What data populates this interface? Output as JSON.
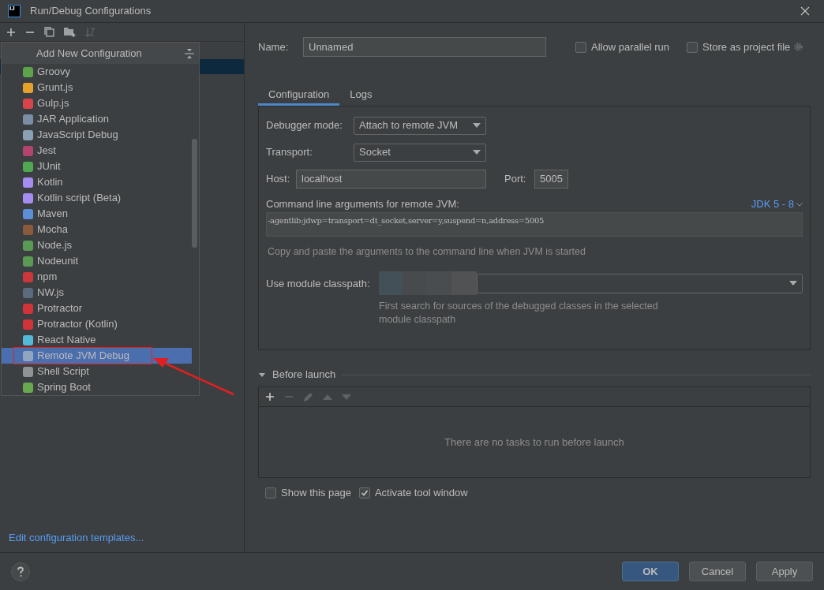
{
  "window": {
    "title": "Run/Debug Configurations",
    "logo": "IJ"
  },
  "popup": {
    "title": "Add New Configuration",
    "items": [
      {
        "label": "Groovy",
        "color": "#5ca34a",
        "selected": false
      },
      {
        "label": "Grunt.js",
        "color": "#e5a12c",
        "selected": false
      },
      {
        "label": "Gulp.js",
        "color": "#d9434b",
        "selected": false
      },
      {
        "label": "JAR Application",
        "color": "#7a8fa6",
        "selected": false
      },
      {
        "label": "JavaScript Debug",
        "color": "#8aa0b4",
        "selected": false
      },
      {
        "label": "Jest",
        "color": "#b4446e",
        "selected": false
      },
      {
        "label": "JUnit",
        "color": "#4fa852",
        "selected": false
      },
      {
        "label": "Kotlin",
        "color": "#a58cf0",
        "selected": false
      },
      {
        "label": "Kotlin script (Beta)",
        "color": "#a58cf0",
        "selected": false
      },
      {
        "label": "Maven",
        "color": "#5d8fd6",
        "selected": false
      },
      {
        "label": "Mocha",
        "color": "#8b5a3c",
        "selected": false
      },
      {
        "label": "Node.js",
        "color": "#5a9a55",
        "selected": false
      },
      {
        "label": "Nodeunit",
        "color": "#5a9a55",
        "selected": false
      },
      {
        "label": "npm",
        "color": "#c9373a",
        "selected": false
      },
      {
        "label": "NW.js",
        "color": "#5b6a7c",
        "selected": false
      },
      {
        "label": "Protractor",
        "color": "#d0343a",
        "selected": false
      },
      {
        "label": "Protractor (Kotlin)",
        "color": "#d0343a",
        "selected": false
      },
      {
        "label": "React Native",
        "color": "#54b9d8",
        "selected": false
      },
      {
        "label": "Remote JVM Debug",
        "color": "#8fa5c0",
        "selected": true
      },
      {
        "label": "Shell Script",
        "color": "#8e9398",
        "selected": false
      },
      {
        "label": "Spring Boot",
        "color": "#6aa84f",
        "selected": false
      }
    ]
  },
  "sidebar": {
    "link": "Edit configuration templates..."
  },
  "form": {
    "name_label": "Name:",
    "name_value": "Unnamed",
    "options": [
      {
        "label": "Allow parallel run",
        "checked": false
      },
      {
        "label": "Store as project file",
        "checked": false
      }
    ],
    "tabs": [
      {
        "label": "Configuration",
        "selected": true
      },
      {
        "label": "Logs",
        "selected": false
      }
    ],
    "debugger_mode": {
      "label": "Debugger mode:",
      "value": "Attach to remote JVM"
    },
    "transport": {
      "label": "Transport:",
      "value": "Socket"
    },
    "host": {
      "label": "Host:",
      "value": "localhost"
    },
    "port": {
      "label": "Port:",
      "value": "5005"
    },
    "args": {
      "label": "Command line arguments for remote JVM:",
      "jdk": "JDK 5 - 8",
      "value": "-agentlib:jdwp=transport=dt_socket,server=y,suspend=n,address=5005",
      "hint": "Copy and paste the arguments to the command line when JVM is started"
    },
    "classpath": {
      "label": "Use module classpath:",
      "hint": "First search for sources of the debugged classes in the selected module classpath"
    },
    "before_launch": {
      "title": "Before launch",
      "expanded": true,
      "empty": "There are no tasks to run before launch"
    },
    "bottom_options": [
      {
        "label": "Show this page",
        "checked": false
      },
      {
        "label": "Activate tool window",
        "checked": true
      }
    ]
  },
  "buttons": [
    {
      "label": "OK",
      "kind": "primary"
    },
    {
      "label": "Cancel",
      "kind": "normal"
    },
    {
      "label": "Apply",
      "kind": "normal"
    }
  ]
}
